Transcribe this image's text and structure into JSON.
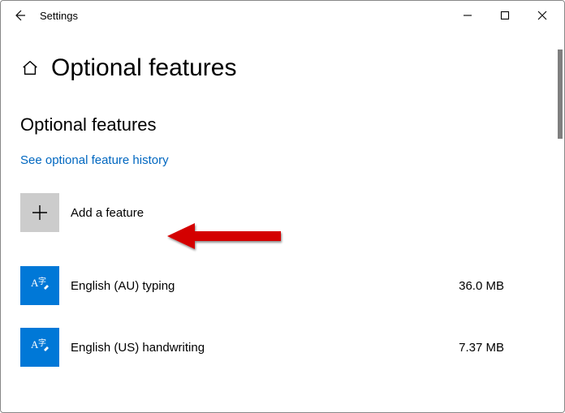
{
  "window": {
    "app_title": "Settings"
  },
  "header": {
    "page_title": "Optional features"
  },
  "section": {
    "title": "Optional features",
    "history_link": "See optional feature history",
    "add_label": "Add a feature"
  },
  "features": [
    {
      "name": "English (AU) typing",
      "size": "36.0 MB"
    },
    {
      "name": "English (US) handwriting",
      "size": "7.37 MB"
    }
  ]
}
